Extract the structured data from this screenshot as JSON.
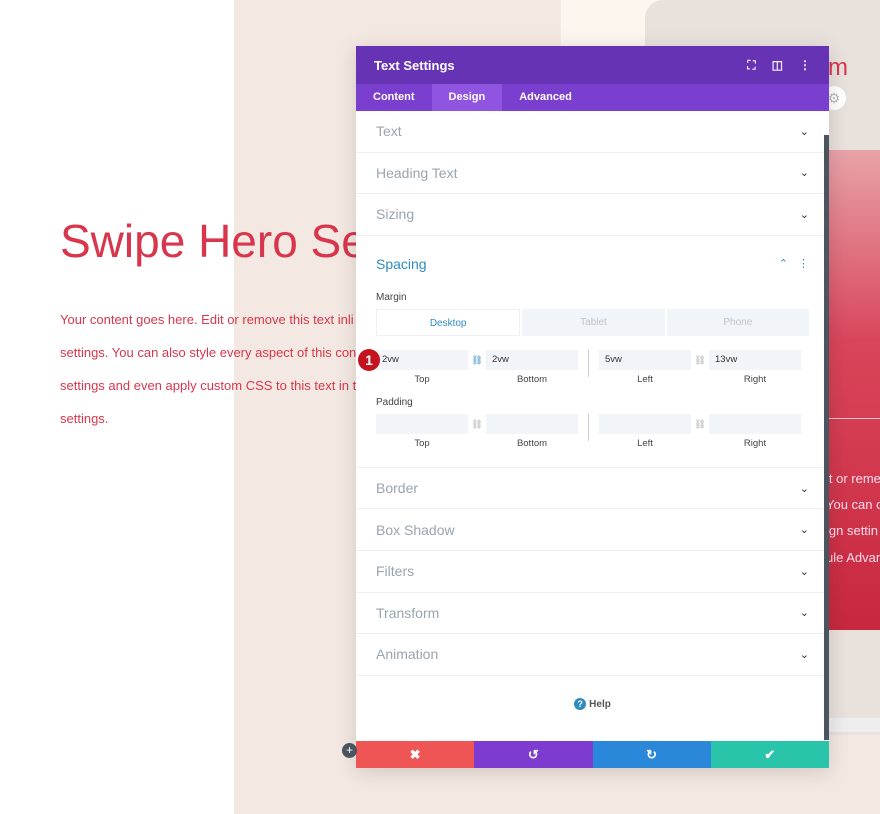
{
  "hero": {
    "title": "Swipe Hero Se",
    "text_lines": [
      "Your content goes here. Edit or remove this text inli",
      "settings. You can also style every aspect of this con",
      "settings and even apply custom CSS to this text in t",
      "settings."
    ]
  },
  "preview": {
    "title_fragment": "m",
    "text_lines": [
      "it or reme",
      "You can c",
      "ign settin",
      "ule Advan"
    ]
  },
  "panel": {
    "title": "Text Settings",
    "tabs": [
      "Content",
      "Design",
      "Advanced"
    ],
    "active_tab": "Design",
    "sections_top": [
      "Text",
      "Heading Text",
      "Sizing"
    ],
    "spacing": {
      "title": "Spacing",
      "margin_label": "Margin",
      "devices": [
        "Desktop",
        "Tablet",
        "Phone"
      ],
      "active_device": "Desktop",
      "margin": {
        "top": "2vw",
        "bottom": "2vw",
        "left": "5vw",
        "right": "13vw"
      },
      "labels": [
        "Top",
        "Bottom",
        "Left",
        "Right"
      ],
      "padding_label": "Padding",
      "step_badge": "1"
    },
    "sections_bottom": [
      "Border",
      "Box Shadow",
      "Filters",
      "Transform",
      "Animation"
    ],
    "help": "Help"
  },
  "colors": {
    "header": "#6633b5",
    "tabs": "#7b3fd0",
    "accent": "#2e8bc0",
    "hero": "#d8364c",
    "cancel": "#ef5555",
    "undo": "#7e3bd0",
    "redo": "#2b87da",
    "save": "#29c4a9"
  }
}
